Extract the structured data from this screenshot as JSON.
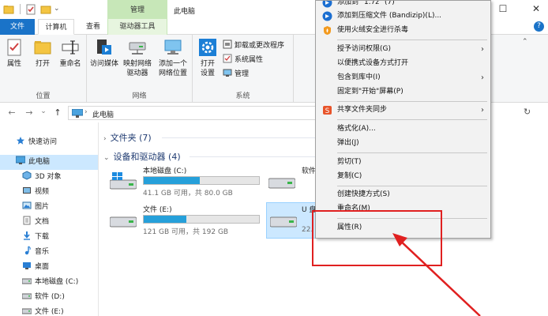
{
  "titlebar": {
    "context_tab": "管理",
    "title": "此电脑",
    "minimize": "—",
    "maximize": "☐",
    "close": "✕"
  },
  "tabs": {
    "file": "文件",
    "computer": "计算机",
    "view": "查看",
    "drive_tools": "驱动器工具",
    "collapse_ribbon": "⌃",
    "help": "?"
  },
  "ribbon": {
    "location": {
      "label": "位置",
      "properties": "属性",
      "open": "打开",
      "rename": "重命名"
    },
    "network": {
      "label": "网络",
      "access_media": "访问媒体",
      "map_drive_1": "映射网络",
      "map_drive_2": "驱动器",
      "add_location_1": "添加一个",
      "add_location_2": "网络位置"
    },
    "system": {
      "label": "系统",
      "open_settings_1": "打开",
      "open_settings_2": "设置",
      "uninstall": "卸载或更改程序",
      "system_properties": "系统属性",
      "manage": "管理"
    }
  },
  "navbar": {
    "back": "←",
    "forward": "→",
    "recent": "⌄",
    "up": "↑",
    "path": "此电脑",
    "refresh": "↻"
  },
  "sidebar": {
    "items": [
      {
        "label": "快速访问",
        "icon": "star-icon"
      },
      {
        "label": "此电脑",
        "icon": "computer-icon"
      },
      {
        "label": "3D 对象",
        "icon": "cube-icon"
      },
      {
        "label": "视频",
        "icon": "video-icon"
      },
      {
        "label": "图片",
        "icon": "picture-icon"
      },
      {
        "label": "文档",
        "icon": "document-icon"
      },
      {
        "label": "下载",
        "icon": "download-icon"
      },
      {
        "label": "音乐",
        "icon": "music-icon"
      },
      {
        "label": "桌面",
        "icon": "desktop-icon"
      },
      {
        "label": "本地磁盘 (C:)",
        "icon": "drive-icon"
      },
      {
        "label": "软件 (D:)",
        "icon": "drive-icon"
      },
      {
        "label": "文件 (E:)",
        "icon": "drive-icon"
      }
    ]
  },
  "content": {
    "folders_header": "文件夹 (7)",
    "devices_header": "设备和驱动器 (4)",
    "drives": [
      {
        "name": "本地磁盘 (C:)",
        "info": "41.1 GB 可用，共 80.0 GB",
        "used_fraction": 0.486,
        "icon": "windows-drive-icon"
      },
      {
        "name": "软件",
        "info": "",
        "used_fraction": 0,
        "icon": "drive-icon"
      },
      {
        "name": "文件 (E:)",
        "info": "121 GB 可用，共 192 GB",
        "used_fraction": 0.37,
        "icon": "drive-icon"
      },
      {
        "name": "U 盘",
        "info": "22.",
        "used_fraction": 0,
        "icon": "usb-drive-icon"
      }
    ]
  },
  "context_menu": {
    "items": [
      {
        "label": "添加到 \"1.7z\" (7)",
        "icon": "bandizip-icon"
      },
      {
        "label": "添加到压缩文件 (Bandizip)(L)...",
        "icon": "bandizip-icon"
      },
      {
        "label": "使用火绒安全进行杀毒",
        "icon": "huorong-icon"
      },
      {
        "label": "授予访问权限(G)",
        "submenu": true
      },
      {
        "label": "以便携式设备方式打开"
      },
      {
        "label": "包含到库中(I)",
        "submenu": true
      },
      {
        "label": "固定到\"开始\"屏幕(P)"
      },
      {
        "label": "共享文件夹同步",
        "icon": "sync-icon",
        "submenu": true
      },
      {
        "label": "格式化(A)..."
      },
      {
        "label": "弹出(J)"
      },
      {
        "label": "剪切(T)"
      },
      {
        "label": "复制(C)"
      },
      {
        "label": "创建快捷方式(S)"
      },
      {
        "label": "重命名(M)"
      },
      {
        "label": "属性(R)"
      }
    ],
    "submenu_arrow": "›"
  },
  "colors": {
    "accent": "#1a73c8",
    "context_tab": "#c7e7b8",
    "selection": "#cce8ff",
    "drive_fill": "#26a0da",
    "annotation": "#e02020"
  }
}
